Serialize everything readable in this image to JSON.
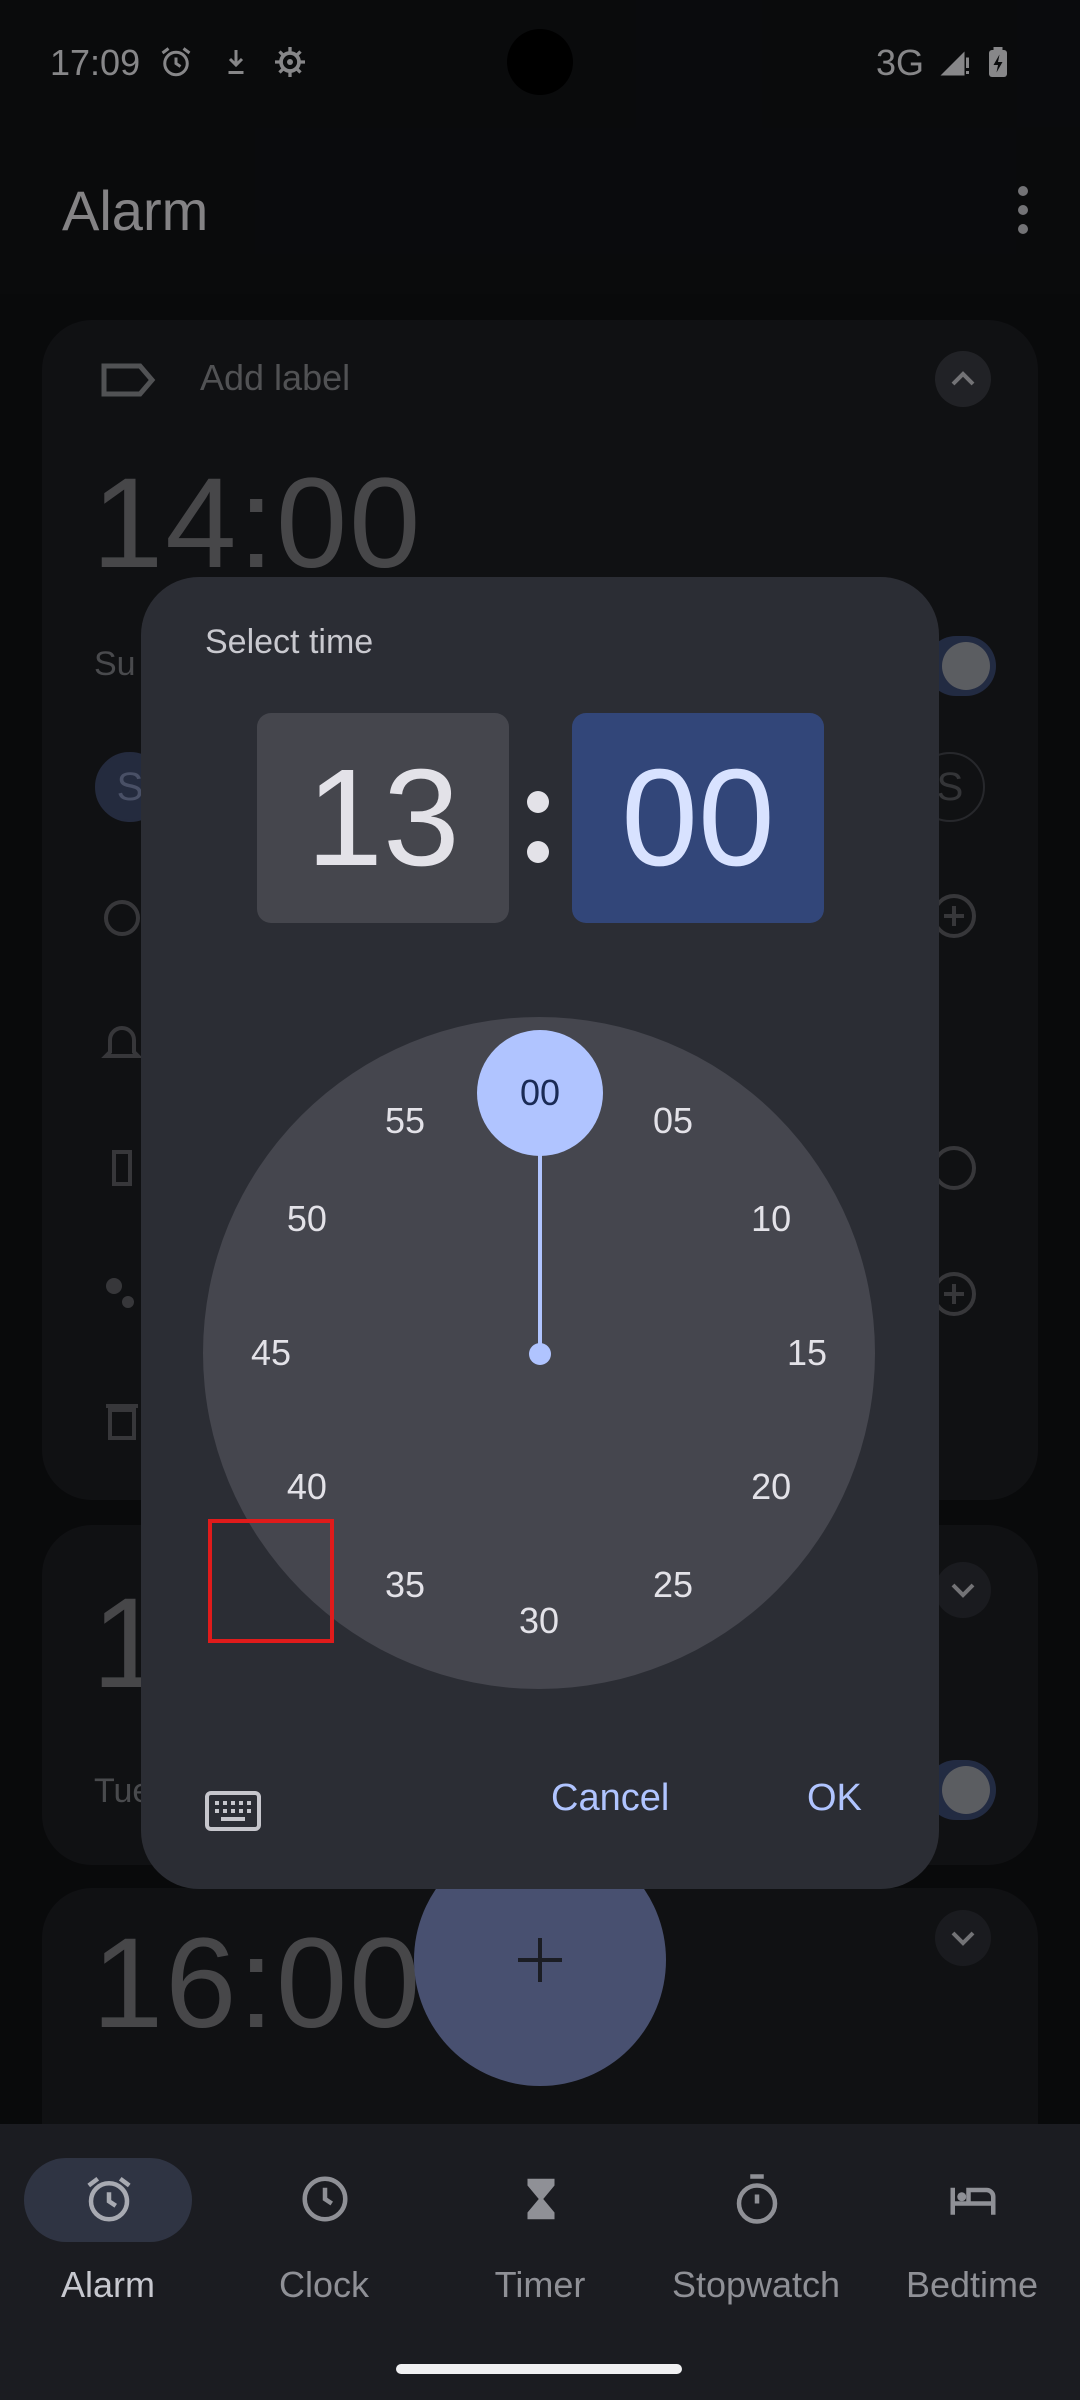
{
  "status_bar": {
    "time": "17:09",
    "network": "3G",
    "icons": [
      "alarm-icon",
      "download-icon",
      "settings-icon",
      "signal-icon",
      "battery-charging-icon"
    ]
  },
  "app_bar": {
    "title": "Alarm",
    "menu_icon": "more-vert-icon"
  },
  "alarms": [
    {
      "add_label": "Add label",
      "time": "14:00",
      "days_visible": "Su",
      "day_chip": "S",
      "enabled": true
    },
    {
      "time": "1",
      "days_visible": "Tue",
      "enabled": true
    },
    {
      "time": "16:00",
      "days_visible": "",
      "enabled": true
    }
  ],
  "dialog": {
    "title": "Select time",
    "hour": "13",
    "minute": "00",
    "selected_minute": "00",
    "minute_ticks": [
      "00",
      "05",
      "10",
      "15",
      "20",
      "25",
      "30",
      "35",
      "40",
      "45",
      "50",
      "55"
    ],
    "cancel_label": "Cancel",
    "ok_label": "OK",
    "keyboard_icon": "keyboard-icon"
  },
  "fab": {
    "icon": "plus-icon"
  },
  "bottom_nav": {
    "items": [
      {
        "label": "Alarm",
        "icon": "alarm-icon",
        "active": true
      },
      {
        "label": "Clock",
        "icon": "clock-icon",
        "active": false
      },
      {
        "label": "Timer",
        "icon": "hourglass-icon",
        "active": false
      },
      {
        "label": "Stopwatch",
        "icon": "stopwatch-icon",
        "active": false
      },
      {
        "label": "Bedtime",
        "icon": "bed-icon",
        "active": false
      }
    ]
  },
  "colors": {
    "accent": "#b0c4ff",
    "dialog_bg": "#2b2d34",
    "minute_box_bg": "#324679",
    "highlight": "#e01b1b"
  }
}
